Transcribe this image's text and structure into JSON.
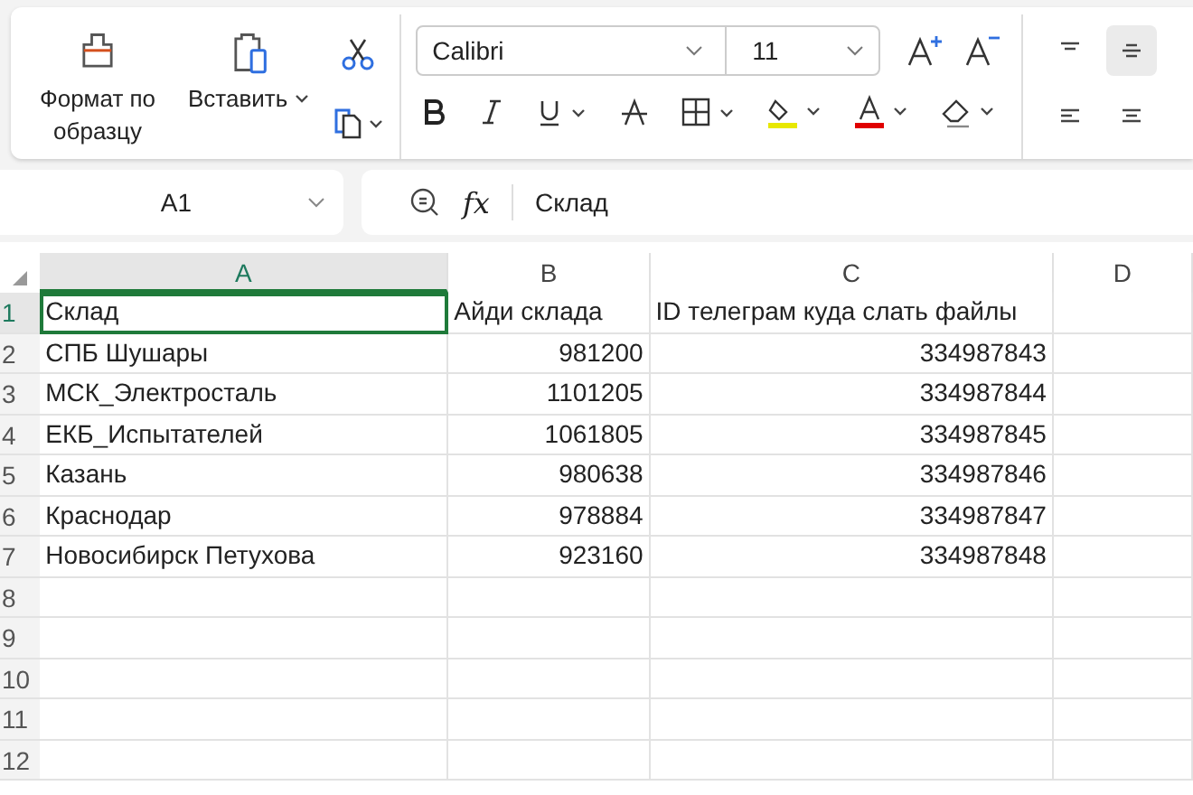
{
  "ribbon": {
    "format_painter": {
      "label": "Формат по образцу"
    },
    "paste": {
      "label": "Вставить"
    },
    "font": {
      "name": "Calibri",
      "size": "11"
    },
    "align_buttons": [
      {
        "kind": "top",
        "selected": false
      },
      {
        "kind": "middle",
        "selected": true
      },
      {
        "kind": "left",
        "selected": false
      },
      {
        "kind": "center",
        "selected": false
      }
    ]
  },
  "name_box": {
    "value": "A1"
  },
  "formula_bar": {
    "function_label": "fx",
    "value": "Склад"
  },
  "columns": [
    {
      "label": "A",
      "selected": true
    },
    {
      "label": "B",
      "selected": false
    },
    {
      "label": "C",
      "selected": false
    },
    {
      "label": "D",
      "selected": false
    }
  ],
  "rows": [
    {
      "number": "1",
      "selected": true,
      "cells": [
        {
          "text": "Склад",
          "kind": "text",
          "selected": true
        },
        {
          "text": "Айди склада",
          "kind": "text",
          "selected": false
        },
        {
          "text": "ID телеграм куда слать файлы",
          "kind": "text",
          "selected": false
        }
      ]
    },
    {
      "number": "2",
      "selected": false,
      "cells": [
        {
          "text": "СПБ Шушары",
          "kind": "text",
          "selected": false
        },
        {
          "text": "981200",
          "kind": "number",
          "selected": false
        },
        {
          "text": "334987843",
          "kind": "number",
          "selected": false
        }
      ]
    },
    {
      "number": "3",
      "selected": false,
      "cells": [
        {
          "text": "МСК_Электросталь",
          "kind": "text",
          "selected": false
        },
        {
          "text": "1101205",
          "kind": "number",
          "selected": false
        },
        {
          "text": "334987844",
          "kind": "number",
          "selected": false
        }
      ]
    },
    {
      "number": "4",
      "selected": false,
      "cells": [
        {
          "text": "ЕКБ_Испытателей",
          "kind": "text",
          "selected": false
        },
        {
          "text": "1061805",
          "kind": "number",
          "selected": false
        },
        {
          "text": "334987845",
          "kind": "number",
          "selected": false
        }
      ]
    },
    {
      "number": "5",
      "selected": false,
      "cells": [
        {
          "text": "Казань",
          "kind": "text",
          "selected": false
        },
        {
          "text": "980638",
          "kind": "number",
          "selected": false
        },
        {
          "text": "334987846",
          "kind": "number",
          "selected": false
        }
      ]
    },
    {
      "number": "6",
      "selected": false,
      "cells": [
        {
          "text": "Краснодар",
          "kind": "text",
          "selected": false
        },
        {
          "text": "978884",
          "kind": "number",
          "selected": false
        },
        {
          "text": "334987847",
          "kind": "number",
          "selected": false
        }
      ]
    },
    {
      "number": "7",
      "selected": false,
      "cells": [
        {
          "text": "Новосибирск Петухова",
          "kind": "text",
          "selected": false
        },
        {
          "text": "923160",
          "kind": "number",
          "selected": false
        },
        {
          "text": "334987848",
          "kind": "number",
          "selected": false
        }
      ]
    },
    {
      "number": "8",
      "selected": false,
      "cells": []
    },
    {
      "number": "9",
      "selected": false,
      "cells": []
    },
    {
      "number": "10",
      "selected": false,
      "cells": []
    },
    {
      "number": "11",
      "selected": false,
      "cells": []
    },
    {
      "number": "12",
      "selected": false,
      "cells": []
    }
  ]
}
